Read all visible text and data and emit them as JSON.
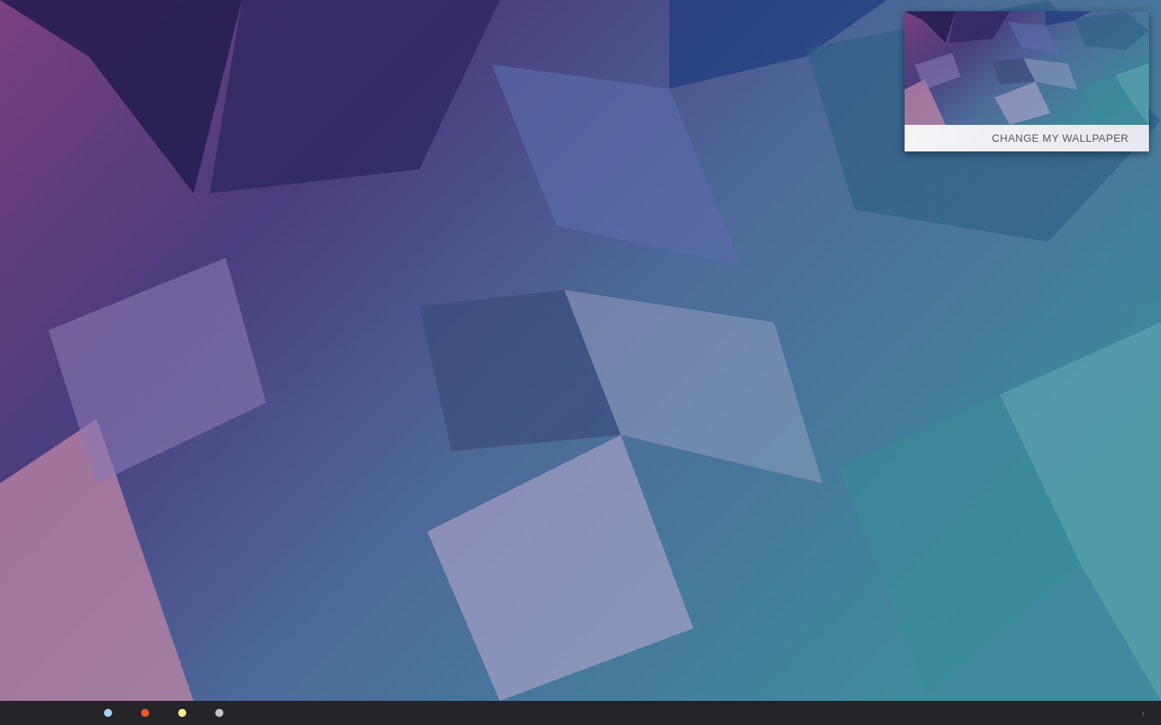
{
  "widget": {
    "kind": "picture",
    "button": "CHANGE MY WALLPAPER"
  },
  "taskbar": {
    "workspaces": [
      {
        "color": "#9fd3f5"
      },
      {
        "color": "#e8592a"
      },
      {
        "color": "#f7f08c"
      },
      {
        "color": "#c8c4c8"
      }
    ],
    "tray_arrow": "‹"
  }
}
